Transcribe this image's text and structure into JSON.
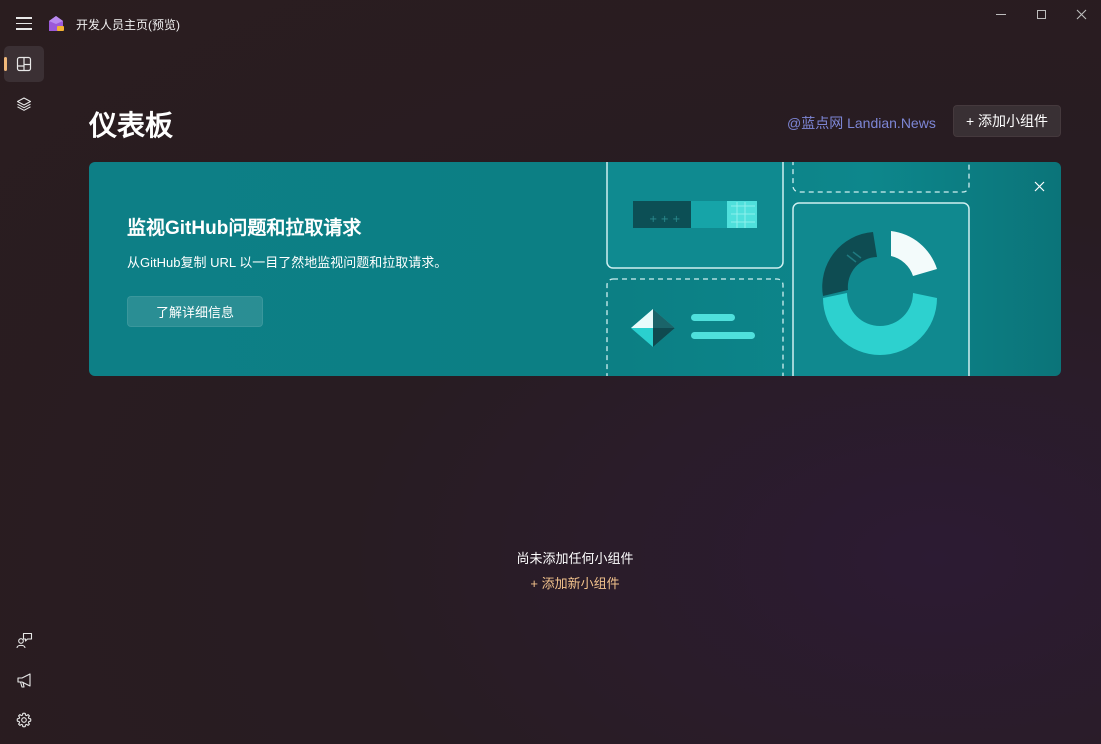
{
  "app": {
    "title": "开发人员主页(预览)"
  },
  "header": {
    "title": "仪表板",
    "watermark": "@蓝点网 Landian.News",
    "add_widget_label": "+ 添加小组件"
  },
  "banner": {
    "title": "监视GitHub问题和拉取请求",
    "description": "从GitHub复制 URL 以一目了然地监视问题和拉取请求。",
    "button_label": "了解详细信息"
  },
  "empty_state": {
    "message": "尚未添加任何小组件",
    "add_link": "+ 添加新小组件"
  },
  "sidebar": {
    "top_items": [
      {
        "icon": "dashboard-icon",
        "active": true
      },
      {
        "icon": "layers-icon",
        "active": false
      }
    ],
    "bottom_items": [
      {
        "icon": "feedback-icon"
      },
      {
        "icon": "megaphone-icon"
      },
      {
        "icon": "settings-gear-icon"
      }
    ]
  },
  "colors": {
    "accent": "#f0b87a",
    "banner": "#0d7f86",
    "watermark": "#7d86d6",
    "link": "#f2c28c"
  }
}
